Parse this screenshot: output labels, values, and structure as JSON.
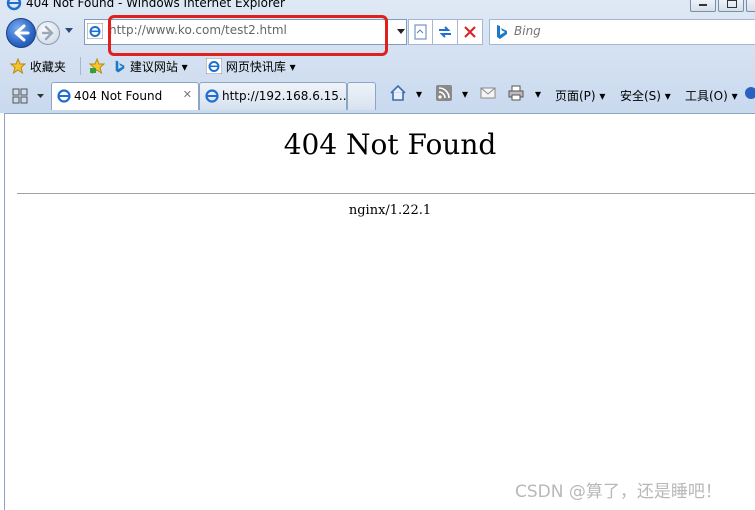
{
  "window": {
    "title": "404 Not Found - Windows Internet Explorer"
  },
  "address_bar": {
    "url": "http://www.ko.com/test2.html"
  },
  "search_box": {
    "placeholder": "Bing"
  },
  "favorites_bar": {
    "favorites_label": "收藏夹",
    "items": [
      {
        "label": "建议网站"
      },
      {
        "label": "网页快讯库"
      }
    ]
  },
  "tabs": [
    {
      "label": "404 Not Found"
    },
    {
      "label": "http://192.168.6.15..."
    }
  ],
  "command_bar": {
    "page_label": "页面(P)",
    "safety_label": "安全(S)",
    "tools_label": "工具(O)"
  },
  "page": {
    "heading": "404 Not Found",
    "server": "nginx/1.22.1"
  },
  "watermark": "CSDN @算了，还是睡吧！",
  "colors": {
    "highlight": "#e0201d",
    "chrome": "#c9d9ee",
    "accent": "#2a64c4"
  },
  "icons": [
    "ie-logo-icon",
    "back-icon",
    "forward-icon",
    "refresh-icon",
    "stop-icon",
    "bing-icon",
    "star-icon",
    "home-icon",
    "rss-icon",
    "mail-icon",
    "print-icon",
    "quick-tabs-icon"
  ]
}
